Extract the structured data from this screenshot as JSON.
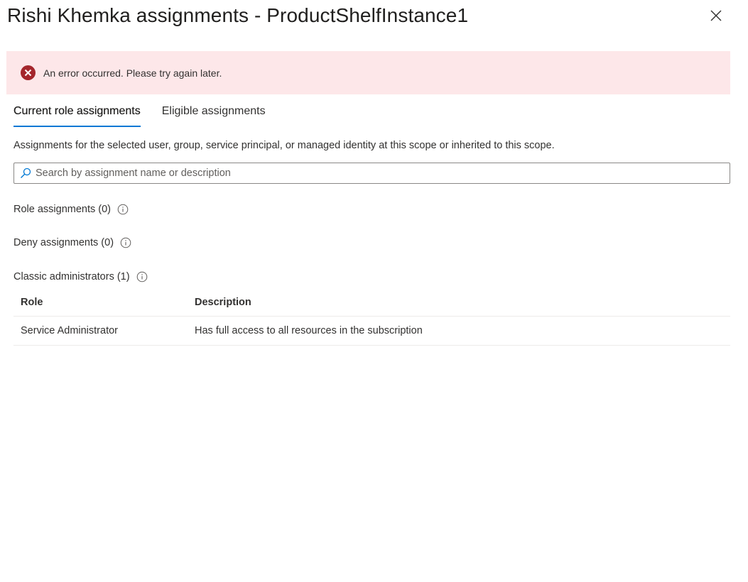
{
  "panel": {
    "title": "Rishi Khemka assignments - ProductShelfInstance1",
    "close_icon": "close-icon"
  },
  "error": {
    "message": "An error occurred. Please try again later.",
    "color": "#a4262c",
    "background": "#fde7e9"
  },
  "tabs": [
    {
      "label": "Current role assignments",
      "active": true
    },
    {
      "label": "Eligible assignments",
      "active": false
    }
  ],
  "description": "Assignments for the selected user, group, service principal, or managed identity at this scope or inherited to this scope.",
  "search": {
    "placeholder": "Search by assignment name or description",
    "value": ""
  },
  "sections": {
    "role_assignments": "Role assignments (0)",
    "deny_assignments": "Deny assignments (0)",
    "classic_administrators": "Classic administrators (1)"
  },
  "table": {
    "headers": {
      "role": "Role",
      "description": "Description"
    },
    "rows": [
      {
        "role": "Service Administrator",
        "description": "Has full access to all resources in the subscription"
      }
    ]
  },
  "colors": {
    "accent": "#0078d4",
    "text": "#323130"
  }
}
